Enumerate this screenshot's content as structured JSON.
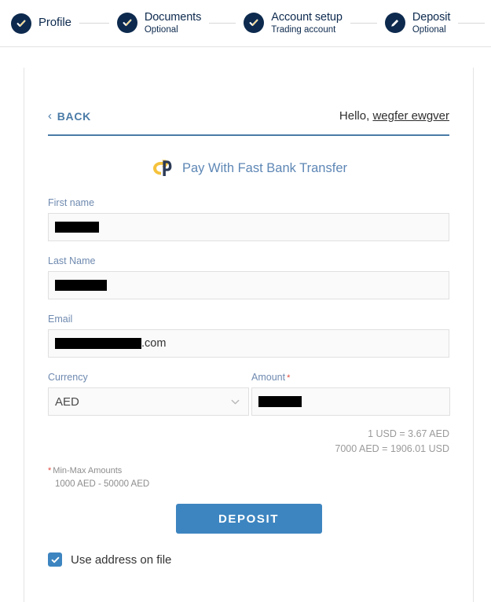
{
  "stepper": {
    "steps": [
      {
        "title": "Profile",
        "sub": "",
        "icon": "check-icon",
        "state": "done"
      },
      {
        "title": "Documents",
        "sub": "Optional",
        "icon": "check-icon",
        "state": "done"
      },
      {
        "title": "Account setup",
        "sub": "Trading account",
        "icon": "check-icon",
        "state": "done"
      },
      {
        "title": "Deposit",
        "sub": "Optional",
        "icon": "pencil-icon",
        "state": "active"
      }
    ],
    "final": {
      "icon": "check-icon",
      "state": "inactive"
    }
  },
  "header": {
    "back_label": "BACK",
    "greeting_prefix": "Hello,",
    "user_name": "wegfer ewgver"
  },
  "provider": {
    "logo": "payment-provider-logo",
    "name": "Pay With Fast Bank Transfer"
  },
  "form": {
    "first_name": {
      "label": "First name",
      "value": "",
      "redacted": true
    },
    "last_name": {
      "label": "Last Name",
      "value": "",
      "redacted": true
    },
    "email": {
      "label": "Email",
      "value": "",
      "redacted": true,
      "suffix": ".com"
    },
    "currency": {
      "label": "Currency",
      "value": "AED",
      "options": [
        "AED"
      ]
    },
    "amount": {
      "label": "Amount",
      "required_mark": "*",
      "value": "",
      "redacted": true
    }
  },
  "rates": {
    "line1": "1 USD = 3.67 AED",
    "line2": "7000 AED = 1906.01 USD"
  },
  "limits": {
    "star": "*",
    "label": "Min-Max Amounts",
    "range": "1000 AED - 50000 AED"
  },
  "actions": {
    "deposit_label": "DEPOSIT",
    "use_address_label": "Use address on file",
    "use_address_checked": true
  },
  "colors": {
    "step_navy": "#0d2a4e",
    "step_inactive": "#a6a6a6",
    "accent_blue": "#3d85c0",
    "link_blue": "#4a7ba7",
    "label_blue": "#6f8ab0",
    "required_red": "#e04a3f",
    "logo_yellow": "#f5c23c",
    "logo_navy": "#2b3a55"
  }
}
